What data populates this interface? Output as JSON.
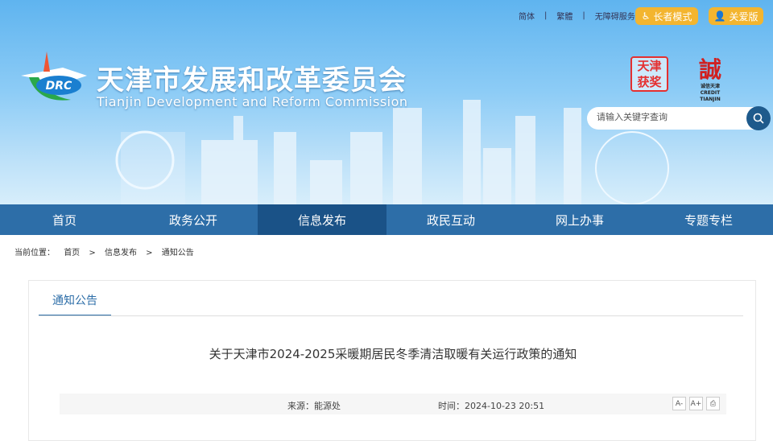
{
  "top_links": [
    "简体",
    "|",
    "繁體",
    "|",
    "无障碍服务"
  ],
  "elder_mode": "长者模式",
  "care_version": "关爱版",
  "site": {
    "title_cn": "天津市发展和改革委员会",
    "title_en": "Tianjin Development and Reform Commission",
    "logo_text": "DRC"
  },
  "seals": {
    "seal1": "天津 获奖",
    "seal2": "誠",
    "seal2_sub": "诚信天津 CREDIT TIANJIN"
  },
  "search": {
    "placeholder": "请输入关键字查询"
  },
  "nav": [
    "首页",
    "政务公开",
    "信息发布",
    "政民互动",
    "网上办事",
    "专题专栏"
  ],
  "breadcrumb": {
    "label": "当前位置：",
    "items": [
      "首页",
      ">",
      "信息发布",
      ">",
      "通知公告"
    ]
  },
  "tab": "通知公告",
  "article": {
    "title": "关于天津市2024-2025采暖期居民冬季清洁取暖有关运行政策的通知",
    "source": "来源：能源处",
    "time": "时间：2024-10-23 20:51"
  },
  "tools": [
    "A-",
    "A+"
  ],
  "colors": {
    "nav": "#2d6ea8",
    "nav_active": "#1a5287",
    "pill": "#f3b52f"
  }
}
